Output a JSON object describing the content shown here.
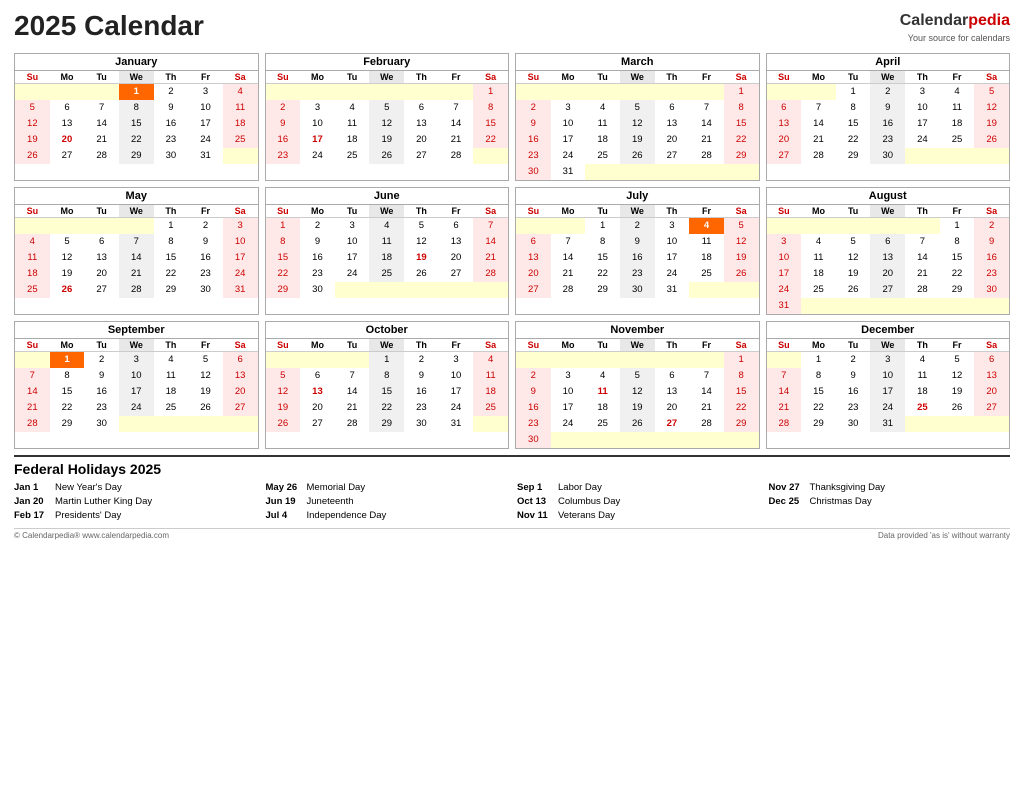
{
  "header": {
    "title": "2025 Calendar",
    "brand_name_calendar": "Calendar",
    "brand_name_pedia": "pedia",
    "tagline": "Your source for calendars"
  },
  "months": [
    {
      "name": "January",
      "weeks": [
        [
          "",
          "",
          "",
          "1",
          "2",
          "3",
          "4"
        ],
        [
          "5",
          "6",
          "7",
          "8",
          "9",
          "10",
          "11"
        ],
        [
          "12",
          "13",
          "14",
          "15",
          "16",
          "17",
          "18"
        ],
        [
          "19",
          "20",
          "21",
          "22",
          "23",
          "24",
          "25"
        ],
        [
          "26",
          "27",
          "28",
          "29",
          "30",
          "31",
          ""
        ]
      ],
      "specials": {
        "1-3": "holiday",
        "20-1": "red",
        "19-1": "su"
      }
    },
    {
      "name": "February",
      "weeks": [
        [
          "",
          "",
          "",
          "",
          "",
          "",
          "1"
        ],
        [
          "2",
          "3",
          "4",
          "5",
          "6",
          "7",
          "8"
        ],
        [
          "9",
          "10",
          "11",
          "12",
          "13",
          "14",
          "15"
        ],
        [
          "16",
          "17",
          "18",
          "19",
          "20",
          "21",
          "22"
        ],
        [
          "23",
          "24",
          "25",
          "26",
          "27",
          "28",
          ""
        ]
      ],
      "specials": {}
    },
    {
      "name": "March",
      "weeks": [
        [
          "",
          "",
          "",
          "",
          "",
          "",
          "1"
        ],
        [
          "2",
          "3",
          "4",
          "5",
          "6",
          "7",
          "8"
        ],
        [
          "9",
          "10",
          "11",
          "12",
          "13",
          "14",
          "15"
        ],
        [
          "16",
          "17",
          "18",
          "19",
          "20",
          "21",
          "22"
        ],
        [
          "23",
          "24",
          "25",
          "26",
          "27",
          "28",
          "29"
        ],
        [
          "30",
          "31",
          "",
          "",
          "",
          "",
          ""
        ]
      ],
      "specials": {}
    },
    {
      "name": "April",
      "weeks": [
        [
          "",
          "",
          "1",
          "2",
          "3",
          "4",
          "5"
        ],
        [
          "6",
          "7",
          "8",
          "9",
          "10",
          "11",
          "12"
        ],
        [
          "13",
          "14",
          "15",
          "16",
          "17",
          "18",
          "19"
        ],
        [
          "20",
          "21",
          "22",
          "23",
          "24",
          "25",
          "26"
        ],
        [
          "27",
          "28",
          "29",
          "30",
          "",
          "",
          ""
        ]
      ],
      "specials": {}
    },
    {
      "name": "May",
      "weeks": [
        [
          "",
          "",
          "",
          "",
          "1",
          "2",
          "3"
        ],
        [
          "4",
          "5",
          "6",
          "7",
          "8",
          "9",
          "10"
        ],
        [
          "11",
          "12",
          "13",
          "14",
          "15",
          "16",
          "17"
        ],
        [
          "18",
          "19",
          "20",
          "21",
          "22",
          "23",
          "24"
        ],
        [
          "25",
          "26",
          "27",
          "28",
          "29",
          "30",
          "31"
        ]
      ],
      "specials": {}
    },
    {
      "name": "June",
      "weeks": [
        [
          "1",
          "2",
          "3",
          "4",
          "5",
          "6",
          "7"
        ],
        [
          "8",
          "9",
          "10",
          "11",
          "12",
          "13",
          "14"
        ],
        [
          "15",
          "16",
          "17",
          "18",
          "19",
          "20",
          "21"
        ],
        [
          "22",
          "23",
          "24",
          "25",
          "26",
          "27",
          "28"
        ],
        [
          "29",
          "30",
          "",
          "",
          "",
          "",
          ""
        ]
      ],
      "specials": {}
    },
    {
      "name": "July",
      "weeks": [
        [
          "",
          "",
          "1",
          "2",
          "3",
          "4",
          "5"
        ],
        [
          "6",
          "7",
          "8",
          "9",
          "10",
          "11",
          "12"
        ],
        [
          "13",
          "14",
          "15",
          "16",
          "17",
          "18",
          "19"
        ],
        [
          "20",
          "21",
          "22",
          "23",
          "24",
          "25",
          "26"
        ],
        [
          "27",
          "28",
          "29",
          "30",
          "31",
          "",
          ""
        ]
      ],
      "specials": {}
    },
    {
      "name": "August",
      "weeks": [
        [
          "",
          "",
          "",
          "",
          "",
          "1",
          "2"
        ],
        [
          "3",
          "4",
          "5",
          "6",
          "7",
          "8",
          "9"
        ],
        [
          "10",
          "11",
          "12",
          "13",
          "14",
          "15",
          "16"
        ],
        [
          "17",
          "18",
          "19",
          "20",
          "21",
          "22",
          "23"
        ],
        [
          "24",
          "25",
          "26",
          "27",
          "28",
          "29",
          "30"
        ],
        [
          "31",
          "",
          "",
          "",
          "",
          "",
          ""
        ]
      ],
      "specials": {}
    },
    {
      "name": "September",
      "weeks": [
        [
          "",
          "1",
          "2",
          "3",
          "4",
          "5",
          "6"
        ],
        [
          "7",
          "8",
          "9",
          "10",
          "11",
          "12",
          "13"
        ],
        [
          "14",
          "15",
          "16",
          "17",
          "18",
          "19",
          "20"
        ],
        [
          "21",
          "22",
          "23",
          "24",
          "25",
          "26",
          "27"
        ],
        [
          "28",
          "29",
          "30",
          "",
          "",
          "",
          ""
        ]
      ],
      "specials": {}
    },
    {
      "name": "October",
      "weeks": [
        [
          "",
          "",
          "",
          "1",
          "2",
          "3",
          "4"
        ],
        [
          "5",
          "6",
          "7",
          "8",
          "9",
          "10",
          "11"
        ],
        [
          "12",
          "13",
          "14",
          "15",
          "16",
          "17",
          "18"
        ],
        [
          "19",
          "20",
          "21",
          "22",
          "23",
          "24",
          "25"
        ],
        [
          "26",
          "27",
          "28",
          "29",
          "30",
          "31",
          ""
        ]
      ],
      "specials": {}
    },
    {
      "name": "November",
      "weeks": [
        [
          "",
          "",
          "",
          "",
          "",
          "",
          "1"
        ],
        [
          "2",
          "3",
          "4",
          "5",
          "6",
          "7",
          "8"
        ],
        [
          "9",
          "10",
          "11",
          "12",
          "13",
          "14",
          "15"
        ],
        [
          "16",
          "17",
          "18",
          "19",
          "20",
          "21",
          "22"
        ],
        [
          "23",
          "24",
          "25",
          "26",
          "27",
          "28",
          "29"
        ],
        [
          "30",
          "",
          "",
          "",
          "",
          "",
          ""
        ]
      ],
      "specials": {}
    },
    {
      "name": "December",
      "weeks": [
        [
          "",
          "1",
          "2",
          "3",
          "4",
          "5",
          "6"
        ],
        [
          "7",
          "8",
          "9",
          "10",
          "11",
          "12",
          "13"
        ],
        [
          "14",
          "15",
          "16",
          "17",
          "18",
          "19",
          "20"
        ],
        [
          "21",
          "22",
          "23",
          "24",
          "25",
          "26",
          "27"
        ],
        [
          "28",
          "29",
          "30",
          "31",
          "",
          "",
          ""
        ]
      ],
      "specials": {}
    }
  ],
  "days": [
    "Su",
    "Mo",
    "Tu",
    "We",
    "Th",
    "Fr",
    "Sa"
  ],
  "holidays_title": "Federal Holidays 2025",
  "holidays": [
    [
      {
        "date": "Jan 1",
        "name": "New Year's Day"
      },
      {
        "date": "Jan 20",
        "name": "Martin Luther King Day"
      },
      {
        "date": "Feb 17",
        "name": "Presidents' Day"
      }
    ],
    [
      {
        "date": "May 26",
        "name": "Memorial Day"
      },
      {
        "date": "Jun 19",
        "name": "Juneteenth"
      },
      {
        "date": "Jul 4",
        "name": "Independence Day"
      }
    ],
    [
      {
        "date": "Sep 1",
        "name": "Labor Day"
      },
      {
        "date": "Oct 13",
        "name": "Columbus Day"
      },
      {
        "date": "Nov 11",
        "name": "Veterans Day"
      }
    ],
    [
      {
        "date": "Nov 27",
        "name": "Thanksgiving Day"
      },
      {
        "date": "Dec 25",
        "name": "Christmas Day"
      }
    ]
  ],
  "footer_left": "© Calendarpedia®  www.calendarpedia.com",
  "footer_right": "Data provided 'as is' without warranty",
  "holiday_highlight_map": {
    "January": {
      "1": "holiday",
      "20": "red"
    },
    "February": {
      "17": "red"
    },
    "March": {},
    "April": {},
    "May": {
      "26": "red"
    },
    "June": {
      "19": "red"
    },
    "July": {
      "4": "holiday"
    },
    "August": {},
    "September": {
      "1": "holiday"
    },
    "October": {
      "13": "red"
    },
    "November": {
      "11": "red",
      "27": "red"
    },
    "December": {
      "25": "red"
    }
  }
}
